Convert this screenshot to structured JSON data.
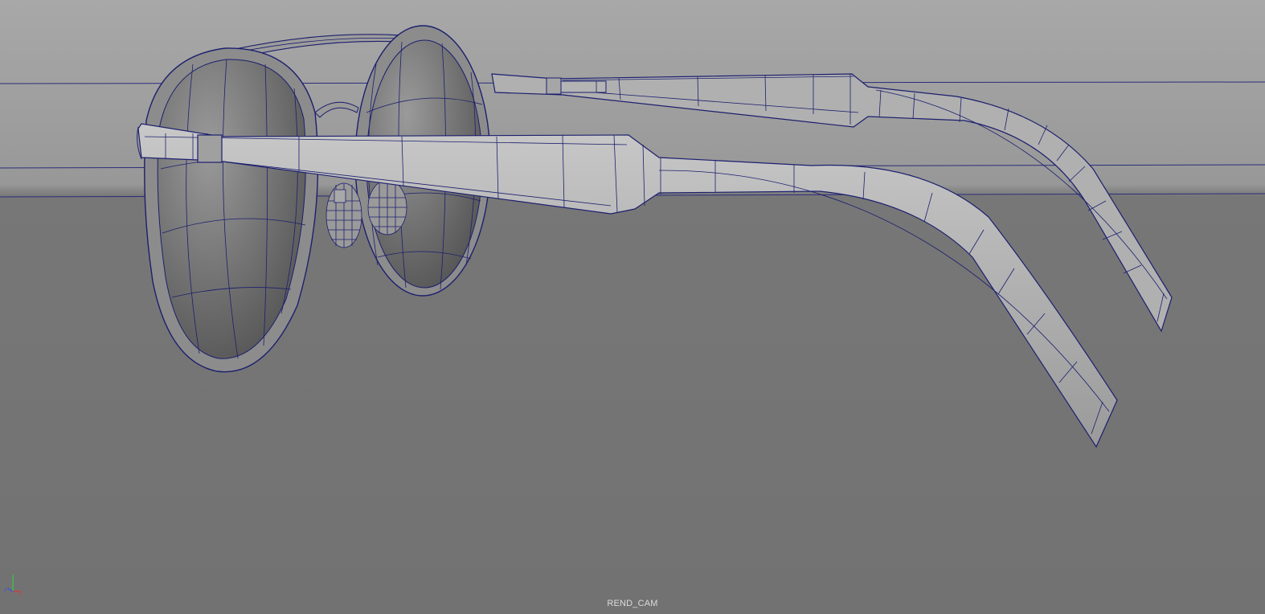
{
  "viewport": {
    "camera_name": "REND_CAM",
    "background_top": "#a2a2a2",
    "background_bottom": "#727272",
    "wire_color": "#1c1f6e",
    "shaded_color": "#b4b4b4"
  },
  "axis_gizmo": {
    "x_label": "x",
    "y_label": "y",
    "z_label": "z",
    "x_color": "#d23a3a",
    "y_color": "#3ac04a",
    "z_color": "#3a5ad2"
  },
  "model": {
    "object": "sunglasses-wireframe-on-shaded"
  }
}
